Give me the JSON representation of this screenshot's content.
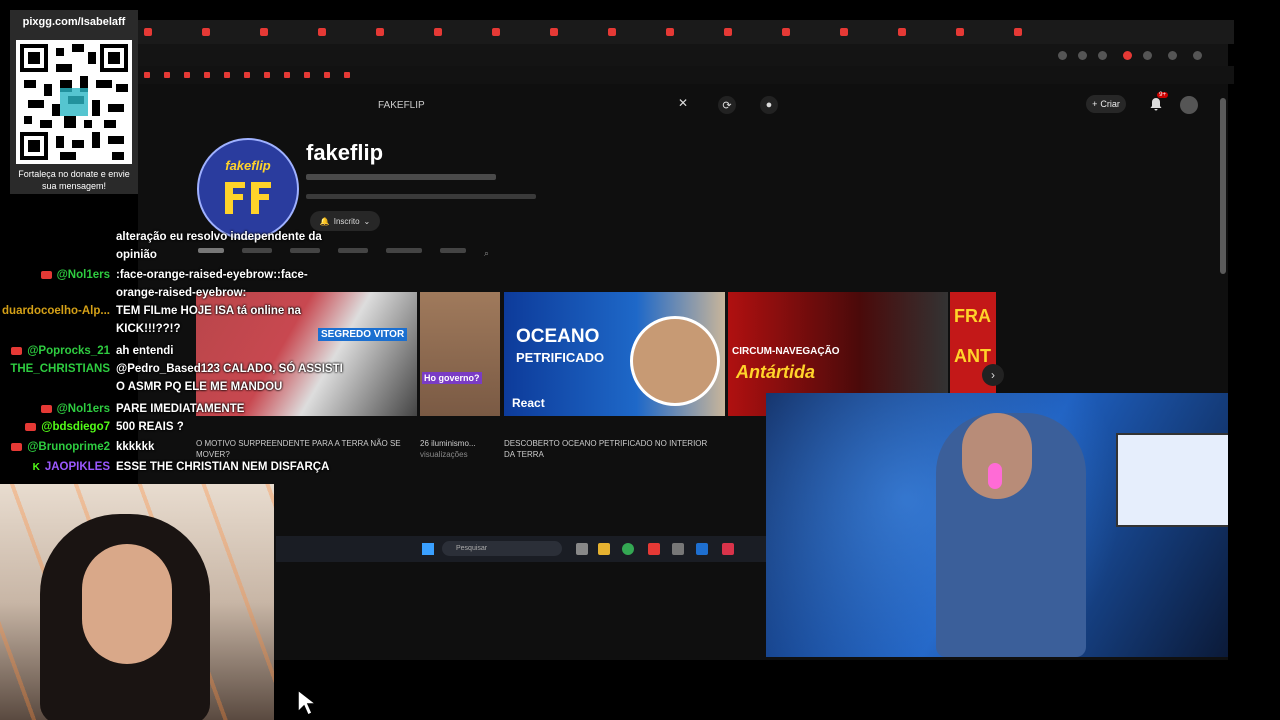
{
  "overlay": {
    "donation_url": "pixgg.com/Isabelaff",
    "donation_caption": "Fortaleça no donate e envie sua mensagem!"
  },
  "browser": {
    "search_query": "FAKEFLIP"
  },
  "youtube": {
    "create_label": "Criar",
    "notification_count": "9+"
  },
  "channel": {
    "logo_text": "fakeflip",
    "name": "fakeflip",
    "subscribe_label": "Inscrito"
  },
  "videos": [
    {
      "thumb_text": "SEGREDO VITOR",
      "title": "O MOTIVO SURPREENDENTE PARA A TERRA NÃO SE MOVER?"
    },
    {
      "thumb_text": "Ho governo?",
      "title": "26 iluminismo...",
      "views": "visualizações"
    },
    {
      "thumb_text_1": "OCEANO",
      "thumb_text_2": "PETRIFICADO",
      "thumb_text_3": "React",
      "title": "DESCOBERTO OCEANO PETRIFICADO NO INTERIOR DA TERRA"
    },
    {
      "thumb_text_1": "CIRCUM-NAVEGAÇÃO",
      "thumb_text_2": "Antártida"
    },
    {
      "thumb_text": "FRA ANT"
    }
  ],
  "taskbar": {
    "search_placeholder": "Pesquisar"
  },
  "chat": [
    {
      "user": "",
      "message": "alteração eu resolvo independente da",
      "user_color": "#ffffff",
      "icon": "none"
    },
    {
      "user": "",
      "message": "opinião",
      "user_color": "#ffffff",
      "icon": "none"
    },
    {
      "user": "@Nol1ers",
      "message": ":face-orange-raised-eyebrow::face-",
      "user_color": "#2ecc40",
      "icon": "youtube"
    },
    {
      "user": "",
      "message": "orange-raised-eyebrow:",
      "user_color": "#ffffff",
      "icon": "none"
    },
    {
      "user": "duardocoelho-Alp...",
      "message": "TEM FILme HOJE ISA tá online na",
      "user_color": "#d4a017",
      "icon": "none"
    },
    {
      "user": "",
      "message": "KICK!!!??!?",
      "user_color": "#ffffff",
      "icon": "none"
    },
    {
      "user": "@Poprocks_21",
      "message": "ah entendi",
      "user_color": "#2ecc40",
      "icon": "youtube"
    },
    {
      "user": "THE_CHRISTIANS",
      "message": "@Pedro_Based123 CALADO, SÓ ASSISTI",
      "user_color": "#2ecc40",
      "icon": "none"
    },
    {
      "user": "",
      "message": "O ASMR PQ ELE ME MANDOU",
      "user_color": "#ffffff",
      "icon": "none"
    },
    {
      "user": "@Nol1ers",
      "message": "PARE IMEDIATAMENTE",
      "user_color": "#2ecc40",
      "icon": "youtube"
    },
    {
      "user": "@bdsdiego7",
      "message": "500 REAIS ?",
      "user_color": "#53fc18",
      "icon": "youtube"
    },
    {
      "user": "@Brunoprime2",
      "message": "kkkkkk",
      "user_color": "#2ecc40",
      "icon": "youtube"
    },
    {
      "user": "JAOPIKLES",
      "message": "ESSE THE CHRISTIAN NEM DISFARÇA",
      "user_color": "#9b59ff",
      "icon": "kick"
    }
  ],
  "colors": {
    "youtube_red": "#e53935",
    "kick_green": "#53fc18",
    "page_bg": "#0f0f0f"
  }
}
